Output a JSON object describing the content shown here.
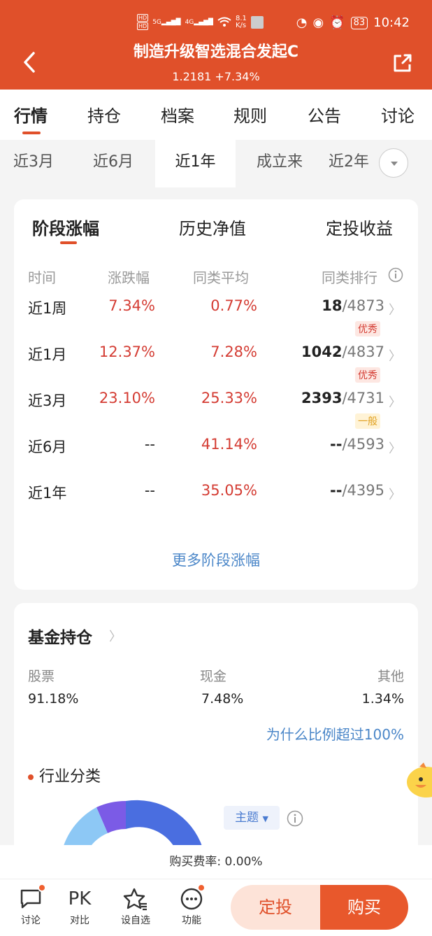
{
  "status": {
    "net_speed": "8.1",
    "net_unit": "K/s",
    "net_5g": "5G",
    "net_4g": "4G",
    "hd": "HD",
    "battery": "83",
    "time": "10:42"
  },
  "header": {
    "title": "制造升级智选混合发起C",
    "subtitle": "1.2181 +7.34%"
  },
  "tabs": [
    "行情",
    "持仓",
    "档案",
    "规则",
    "公告",
    "讨论"
  ],
  "ranges": [
    "近3月",
    "近6月",
    "近1年",
    "成立来",
    "近2年"
  ],
  "perf": {
    "sub_tabs": [
      "阶段涨幅",
      "历史净值",
      "定投收益"
    ],
    "headers": {
      "time": "时间",
      "change": "涨跌幅",
      "avg": "同类平均",
      "rank": "同类排行"
    },
    "rows": [
      {
        "time": "近1周",
        "change": "7.34%",
        "avg": "0.77%",
        "rank": "18",
        "total": "/4873",
        "badge": "优秀"
      },
      {
        "time": "近1月",
        "change": "12.37%",
        "avg": "7.28%",
        "rank": "1042",
        "total": "/4837",
        "badge": "优秀"
      },
      {
        "time": "近3月",
        "change": "23.10%",
        "avg": "25.33%",
        "rank": "2393",
        "total": "/4731",
        "badge": "一般"
      },
      {
        "time": "近6月",
        "change": "--",
        "avg": "41.14%",
        "rank": "--",
        "total": "/4593",
        "badge": ""
      },
      {
        "time": "近1年",
        "change": "--",
        "avg": "35.05%",
        "rank": "--",
        "total": "/4395",
        "badge": ""
      }
    ],
    "more": "更多阶段涨幅"
  },
  "holdings": {
    "title": "基金持仓",
    "stock_label": "股票",
    "stock_value": "91.18%",
    "cash_label": "现金",
    "cash_value": "7.48%",
    "other_label": "其他",
    "other_value": "1.34%",
    "why": "为什么比例超过100%",
    "industry_title": "行业分类",
    "theme_label": "主题"
  },
  "fee": "购买费率: 0.00%",
  "bottom_nav": [
    {
      "label": "讨论",
      "icon": "chat-icon"
    },
    {
      "label": "对比",
      "icon_text": "PK"
    },
    {
      "label": "设自选",
      "icon": "star-list-icon"
    },
    {
      "label": "功能",
      "icon": "more-icon"
    }
  ],
  "buttons": {
    "dingtou": "定投",
    "buy": "购买"
  },
  "colors": {
    "brand": "#e0502a",
    "up": "#d43c33",
    "link": "#4a86c8"
  }
}
